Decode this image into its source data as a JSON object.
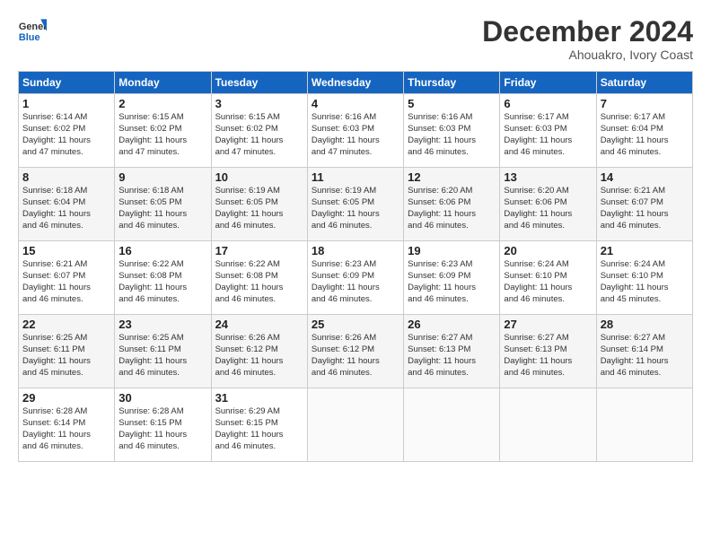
{
  "logo": {
    "line1": "General",
    "line2": "Blue"
  },
  "title": "December 2024",
  "subtitle": "Ahouakro, Ivory Coast",
  "days_of_week": [
    "Sunday",
    "Monday",
    "Tuesday",
    "Wednesday",
    "Thursday",
    "Friday",
    "Saturday"
  ],
  "weeks": [
    [
      {
        "day": "1",
        "info": "Sunrise: 6:14 AM\nSunset: 6:02 PM\nDaylight: 11 hours\nand 47 minutes."
      },
      {
        "day": "2",
        "info": "Sunrise: 6:15 AM\nSunset: 6:02 PM\nDaylight: 11 hours\nand 47 minutes."
      },
      {
        "day": "3",
        "info": "Sunrise: 6:15 AM\nSunset: 6:02 PM\nDaylight: 11 hours\nand 47 minutes."
      },
      {
        "day": "4",
        "info": "Sunrise: 6:16 AM\nSunset: 6:03 PM\nDaylight: 11 hours\nand 47 minutes."
      },
      {
        "day": "5",
        "info": "Sunrise: 6:16 AM\nSunset: 6:03 PM\nDaylight: 11 hours\nand 46 minutes."
      },
      {
        "day": "6",
        "info": "Sunrise: 6:17 AM\nSunset: 6:03 PM\nDaylight: 11 hours\nand 46 minutes."
      },
      {
        "day": "7",
        "info": "Sunrise: 6:17 AM\nSunset: 6:04 PM\nDaylight: 11 hours\nand 46 minutes."
      }
    ],
    [
      {
        "day": "8",
        "info": "Sunrise: 6:18 AM\nSunset: 6:04 PM\nDaylight: 11 hours\nand 46 minutes."
      },
      {
        "day": "9",
        "info": "Sunrise: 6:18 AM\nSunset: 6:05 PM\nDaylight: 11 hours\nand 46 minutes."
      },
      {
        "day": "10",
        "info": "Sunrise: 6:19 AM\nSunset: 6:05 PM\nDaylight: 11 hours\nand 46 minutes."
      },
      {
        "day": "11",
        "info": "Sunrise: 6:19 AM\nSunset: 6:05 PM\nDaylight: 11 hours\nand 46 minutes."
      },
      {
        "day": "12",
        "info": "Sunrise: 6:20 AM\nSunset: 6:06 PM\nDaylight: 11 hours\nand 46 minutes."
      },
      {
        "day": "13",
        "info": "Sunrise: 6:20 AM\nSunset: 6:06 PM\nDaylight: 11 hours\nand 46 minutes."
      },
      {
        "day": "14",
        "info": "Sunrise: 6:21 AM\nSunset: 6:07 PM\nDaylight: 11 hours\nand 46 minutes."
      }
    ],
    [
      {
        "day": "15",
        "info": "Sunrise: 6:21 AM\nSunset: 6:07 PM\nDaylight: 11 hours\nand 46 minutes."
      },
      {
        "day": "16",
        "info": "Sunrise: 6:22 AM\nSunset: 6:08 PM\nDaylight: 11 hours\nand 46 minutes."
      },
      {
        "day": "17",
        "info": "Sunrise: 6:22 AM\nSunset: 6:08 PM\nDaylight: 11 hours\nand 46 minutes."
      },
      {
        "day": "18",
        "info": "Sunrise: 6:23 AM\nSunset: 6:09 PM\nDaylight: 11 hours\nand 46 minutes."
      },
      {
        "day": "19",
        "info": "Sunrise: 6:23 AM\nSunset: 6:09 PM\nDaylight: 11 hours\nand 46 minutes."
      },
      {
        "day": "20",
        "info": "Sunrise: 6:24 AM\nSunset: 6:10 PM\nDaylight: 11 hours\nand 46 minutes."
      },
      {
        "day": "21",
        "info": "Sunrise: 6:24 AM\nSunset: 6:10 PM\nDaylight: 11 hours\nand 45 minutes."
      }
    ],
    [
      {
        "day": "22",
        "info": "Sunrise: 6:25 AM\nSunset: 6:11 PM\nDaylight: 11 hours\nand 45 minutes."
      },
      {
        "day": "23",
        "info": "Sunrise: 6:25 AM\nSunset: 6:11 PM\nDaylight: 11 hours\nand 46 minutes."
      },
      {
        "day": "24",
        "info": "Sunrise: 6:26 AM\nSunset: 6:12 PM\nDaylight: 11 hours\nand 46 minutes."
      },
      {
        "day": "25",
        "info": "Sunrise: 6:26 AM\nSunset: 6:12 PM\nDaylight: 11 hours\nand 46 minutes."
      },
      {
        "day": "26",
        "info": "Sunrise: 6:27 AM\nSunset: 6:13 PM\nDaylight: 11 hours\nand 46 minutes."
      },
      {
        "day": "27",
        "info": "Sunrise: 6:27 AM\nSunset: 6:13 PM\nDaylight: 11 hours\nand 46 minutes."
      },
      {
        "day": "28",
        "info": "Sunrise: 6:27 AM\nSunset: 6:14 PM\nDaylight: 11 hours\nand 46 minutes."
      }
    ],
    [
      {
        "day": "29",
        "info": "Sunrise: 6:28 AM\nSunset: 6:14 PM\nDaylight: 11 hours\nand 46 minutes."
      },
      {
        "day": "30",
        "info": "Sunrise: 6:28 AM\nSunset: 6:15 PM\nDaylight: 11 hours\nand 46 minutes."
      },
      {
        "day": "31",
        "info": "Sunrise: 6:29 AM\nSunset: 6:15 PM\nDaylight: 11 hours\nand 46 minutes."
      },
      {
        "day": "",
        "info": ""
      },
      {
        "day": "",
        "info": ""
      },
      {
        "day": "",
        "info": ""
      },
      {
        "day": "",
        "info": ""
      }
    ]
  ]
}
